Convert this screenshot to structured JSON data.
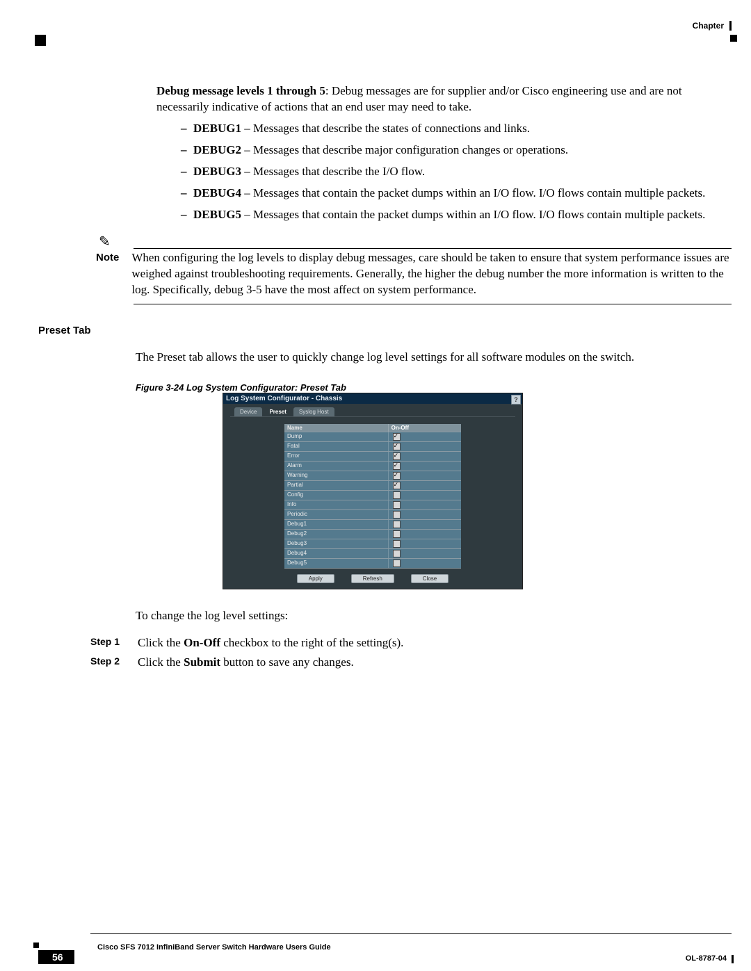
{
  "header": {
    "label": "Chapter"
  },
  "intro": {
    "lead_bold": "Debug message levels 1 through 5",
    "lead_rest": ": Debug messages are for supplier and/or Cisco engineering use and are not necessarily indicative of actions that an end user may need to take."
  },
  "debug_items": [
    {
      "name": "DEBUG1",
      "desc": " – Messages that describe the states of connections and links."
    },
    {
      "name": "DEBUG2",
      "desc": " – Messages that describe major configuration changes or operations."
    },
    {
      "name": "DEBUG3",
      "desc": " – Messages that describe the I/O flow."
    },
    {
      "name": "DEBUG4",
      "desc": " – Messages that contain the packet dumps within an I/O flow. I/O flows contain multiple packets."
    },
    {
      "name": "DEBUG5",
      "desc": " – Messages that contain the packet dumps within an I/O flow. I/O flows contain multiple packets."
    }
  ],
  "note": {
    "label": "Note",
    "text": "When configuring the log levels to display debug messages, care should be taken to ensure that system performance issues are weighed against troubleshooting requirements. Generally, the higher the debug number the more information is written to the log. Specifically, debug 3-5 have the most affect on system performance."
  },
  "section": {
    "heading": "Preset Tab",
    "para": "The Preset tab allows the user to quickly change log level settings for all software modules on the switch."
  },
  "figure": {
    "caption": "Figure 3-24   Log System Configurator: Preset Tab"
  },
  "shot": {
    "title": "Log System Configurator - Chassis",
    "help": "?",
    "tabs": [
      "Device",
      "Preset",
      "Syslog Host"
    ],
    "col_name": "Name",
    "col_onoff": "On-Off",
    "rows": [
      {
        "name": "Dump",
        "checked": true
      },
      {
        "name": "Fatal",
        "checked": true
      },
      {
        "name": "Error",
        "checked": true
      },
      {
        "name": "Alarm",
        "checked": true
      },
      {
        "name": "Warning",
        "checked": true
      },
      {
        "name": "Partial",
        "checked": true
      },
      {
        "name": "Config",
        "checked": false
      },
      {
        "name": "Info",
        "checked": false
      },
      {
        "name": "Periodic",
        "checked": false
      },
      {
        "name": "Debug1",
        "checked": false
      },
      {
        "name": "Debug2",
        "checked": false
      },
      {
        "name": "Debug3",
        "checked": false
      },
      {
        "name": "Debug4",
        "checked": false
      },
      {
        "name": "Debug5",
        "checked": false
      }
    ],
    "buttons": {
      "apply": "Apply",
      "refresh": "Refresh",
      "close": "Close"
    }
  },
  "after_fig": "To change the log level settings:",
  "steps": [
    {
      "label": "Step 1",
      "pre": "Click the ",
      "bold": "On-Off",
      "post": " checkbox to the right of the setting(s)."
    },
    {
      "label": "Step 2",
      "pre": "Click the ",
      "bold": "Submit",
      "post": " button to save any changes."
    }
  ],
  "footer": {
    "guide": "Cisco SFS 7012 InfiniBand Server Switch Hardware Users Guide",
    "page": "56",
    "doc": "OL-8787-04"
  }
}
